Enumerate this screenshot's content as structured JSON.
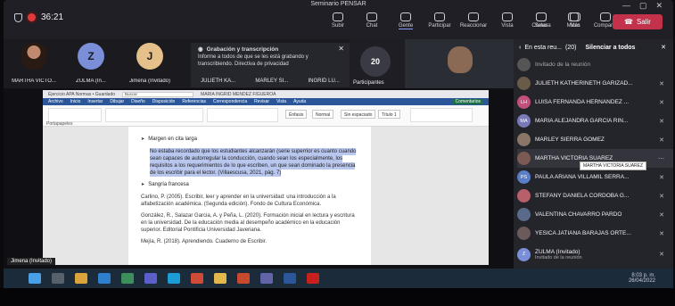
{
  "window": {
    "title": "Seminario PENSAR",
    "controls": [
      "—",
      "▢",
      "✕"
    ]
  },
  "topbar": {
    "time": "36:21",
    "tools": [
      {
        "label": "Subir",
        "icon": "share-icon"
      },
      {
        "label": "Chat",
        "icon": "chat-icon"
      },
      {
        "label": "Gente",
        "icon": "people-icon",
        "active": true
      },
      {
        "label": "Participar",
        "icon": "raise-hand-icon"
      },
      {
        "label": "Reaccionar",
        "icon": "smile-icon"
      },
      {
        "label": "Vista",
        "icon": "grid-icon"
      },
      {
        "label": "Salas",
        "icon": "rooms-icon"
      },
      {
        "label": "Más",
        "icon": "more-icon"
      }
    ],
    "right_tools": [
      {
        "label": "Cámara",
        "icon": "camera-icon"
      },
      {
        "label": "Micro",
        "icon": "mic-icon"
      },
      {
        "label": "Compartir",
        "icon": "share-up-icon"
      }
    ],
    "leave": "Salir"
  },
  "tiles": [
    {
      "name": "MARTHA VICTO...",
      "initial": "",
      "color": ""
    },
    {
      "name": "ZULMA (In...",
      "initial": "Z",
      "color": "#7a8fd8"
    },
    {
      "name": "Jimena (Invitado)",
      "initial": "J",
      "color": "#e6c08a"
    },
    {
      "name": "JULIETH KA...",
      "initial": "",
      "color": ""
    },
    {
      "name": "MARLEY SI...",
      "initial": "",
      "color": ""
    },
    {
      "name": "INGRID LU...",
      "initial": "",
      "color": ""
    }
  ],
  "toast": {
    "title": "Grabación y transcripción",
    "body": "Informe a todos de que se les está grabando y transcribiendo. Directiva de privacidad"
  },
  "count_tile": {
    "count": "20",
    "label": "Participantes"
  },
  "document": {
    "titlebar": "Ejercicio APA Normas • Guardado",
    "search": "Buscar",
    "user": "MARIA INGRID MENDEZ FIGUEROA",
    "tabs": [
      "Archivo",
      "Inicio",
      "Insertar",
      "Dibujar",
      "Diseño",
      "Disposición",
      "Referencias",
      "Correspondencia",
      "Revisar",
      "Vista",
      "Ayuda"
    ],
    "comment_btn": "Comentarios",
    "style_chips": [
      "Énfasis",
      "Normal",
      "Sin espaciado",
      "Título 1"
    ],
    "left_label": "Portapapeles",
    "bullet1": "Margen en cita larga",
    "quote": "No estaba recordado que los estudiantes alcanzarán (serie superrior es cuanto cuando sean capaces de autorregular la conducción, cuando sean los especialmente, los requisitos a los requerimientos de lo que escriben, un que sean dominado la presencia de los escribir para el lector. (Villaescusa, 2021, pág. 7)",
    "bullet2": "Sangría francesa",
    "ref1": "Carlino, P. (2005). Escribir, leer y aprender en la universidad: una introducción a la alfabetización académica. (Segunda edición). Fondo de Cultura Económica.",
    "ref2": "González, R., Salazar Garcia, A. y Peña, L. (2020). Formación inicial en lectura y escritura en la universidad. De la educación media al desempeño académico en la educación superior. Editorial Pontificia Universidad Javeriana.",
    "ref3": "Mejía, R. (2018). Aprendiendo. Cuaderno de Escribir.",
    "owner": "Jimena (Invitado)"
  },
  "panel": {
    "title": "En esta reu...",
    "count": "(20)",
    "mute_all": "Silenciar a todos",
    "close": "✕",
    "tooltip": "MARTHA VICTORIA SUAREZ",
    "participants": [
      {
        "name": "Invitado de la reunión",
        "initials": "",
        "color": "#555",
        "sub": ""
      },
      {
        "name": "JULIETH KATHERINETH GARIZAD...",
        "initials": "",
        "color": "#6a5a4a",
        "sub": ""
      },
      {
        "name": "LUISA FERNANDA HERNANDEZ ...",
        "initials": "LH",
        "color": "#c2507a",
        "sub": ""
      },
      {
        "name": "MARIA ALEJANDRA GARCIA RIN...",
        "initials": "MA",
        "color": "#7a7ab8",
        "sub": ""
      },
      {
        "name": "MARLEY SIERRA GÓMEZ",
        "initials": "",
        "color": "#8a7666",
        "sub": ""
      },
      {
        "name": "MARTHA VICTORIA SUAREZ",
        "initials": "",
        "color": "#7a5a52",
        "sub": ""
      },
      {
        "name": "PAULA ARIANA VILLAMIL SERRA...",
        "initials": "PS",
        "color": "#5a7fc8",
        "sub": ""
      },
      {
        "name": "STEFANY DANIELA CORDOBA G...",
        "initials": "",
        "color": "#b8606a",
        "sub": ""
      },
      {
        "name": "VALENTINA CHAVARRO PARDO",
        "initials": "",
        "color": "#5a6a8a",
        "sub": ""
      },
      {
        "name": "YESICA JATIANA BARAJAS ORTE...",
        "initials": "",
        "color": "#6a5a5a",
        "sub": ""
      },
      {
        "name": "ZULMA (Invitado)",
        "initials": "Z",
        "color": "#7a8fd8",
        "sub": "Invitado de la reunión"
      }
    ]
  },
  "taskbar": {
    "clock": "8:03 p. m.",
    "date": "26/04/2022",
    "icons": [
      "windows-icon",
      "search-icon",
      "files-icon",
      "mail-icon",
      "store-icon",
      "teams-icon",
      "edge-icon",
      "chrome-icon",
      "folder-icon",
      "powerpoint-icon",
      "teams-icon-2",
      "word-icon",
      "acrobat-icon"
    ]
  },
  "colors": {
    "leave": "#c4314b",
    "panel": "#24242b",
    "taskbar": "#1c2b3a",
    "word_blue": "#2b579a"
  }
}
